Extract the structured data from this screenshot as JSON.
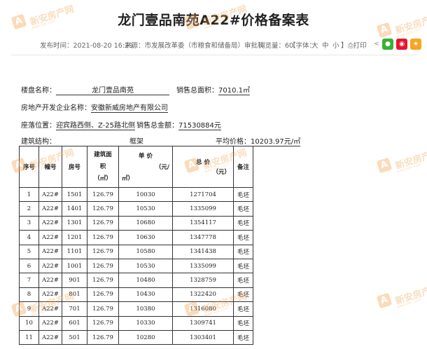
{
  "page": {
    "title": "龙门壹品南苑A22#价格备案表"
  },
  "meta": {
    "publish": "发布时间：2021-08-20 16:29",
    "source": "来源：市发展改革委（市粮食和储备局）审批科",
    "views": "浏览量：60",
    "font_label": "【字体：",
    "font_large": "大",
    "font_medium": "中",
    "font_small": "小",
    "font_end": "】",
    "print": "打印",
    "share_icons": [
      "share-icon",
      "wechat-icon",
      "weibo-icon",
      "favorite-icon"
    ]
  },
  "info": {
    "project_label": "楼盘名称：",
    "project_value": "龙门壹品南苑",
    "total_area_label": "销售总面积：",
    "total_area_value": "7010.1㎡",
    "developer_label": "房地产开发企业名称：",
    "developer_value": "安徽新威房地产有限公司",
    "location_label": "座落位置：",
    "location_value": "迎宾路西侧、Z-25路北侧",
    "total_amount_label": "销售总金额：",
    "total_amount_value": "71530884元",
    "structure_label": "建筑结构：",
    "structure_value": "框架",
    "avg_price_label": "平均价格：",
    "avg_price_value": "10203.97元/㎡"
  },
  "table": {
    "headers": {
      "seq": "序号",
      "building": "幢号",
      "room": "房号",
      "area_1": "建筑面",
      "area_2": "积",
      "area_3": "（㎡）",
      "price_1": "单 价",
      "price_2": "（元/",
      "price_3": "㎡）",
      "total_1": "总 价",
      "total_2": "（元）",
      "remark": "备注"
    },
    "rows": [
      {
        "seq": "1",
        "building": "A22#",
        "room": "1501",
        "area": "126.79",
        "price": "10030",
        "total": "1271704",
        "remark": "毛坯"
      },
      {
        "seq": "2",
        "building": "A22#",
        "room": "1401",
        "area": "126.79",
        "price": "10530",
        "total": "1335099",
        "remark": "毛坯"
      },
      {
        "seq": "3",
        "building": "A22#",
        "room": "1301",
        "area": "126.79",
        "price": "10680",
        "total": "1354117",
        "remark": "毛坯"
      },
      {
        "seq": "4",
        "building": "A22#",
        "room": "1201",
        "area": "126.79",
        "price": "10630",
        "total": "1347778",
        "remark": "毛坯"
      },
      {
        "seq": "5",
        "building": "A22#",
        "room": "1101",
        "area": "126.79",
        "price": "10580",
        "total": "1341438",
        "remark": "毛坯"
      },
      {
        "seq": "6",
        "building": "A22#",
        "room": "1001",
        "area": "126.79",
        "price": "10530",
        "total": "1335099",
        "remark": "毛坯"
      },
      {
        "seq": "7",
        "building": "A22#",
        "room": "901",
        "area": "126.79",
        "price": "10480",
        "total": "1328759",
        "remark": "毛坯"
      },
      {
        "seq": "8",
        "building": "A22#",
        "room": "801",
        "area": "126.79",
        "price": "10430",
        "total": "1322420",
        "remark": "毛坯"
      },
      {
        "seq": "9",
        "building": "A22#",
        "room": "701",
        "area": "126.79",
        "price": "10380",
        "total": "1316080",
        "remark": "毛坯"
      },
      {
        "seq": "10",
        "building": "A22#",
        "room": "601",
        "area": "126.79",
        "price": "10330",
        "total": "1309741",
        "remark": "毛坯"
      },
      {
        "seq": "11",
        "building": "A22#",
        "room": "501",
        "area": "126.79",
        "price": "10280",
        "total": "1303401",
        "remark": "毛坯"
      }
    ]
  },
  "watermark": {
    "text": "新安房产网",
    "sub": "www.xafc.com",
    "badge": "A"
  }
}
